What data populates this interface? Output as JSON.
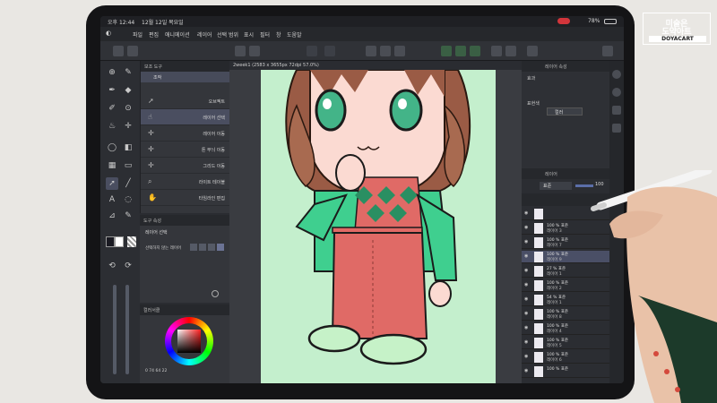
{
  "statusbar": {
    "time": "오후 12:44",
    "date": "12월 12일 목요일",
    "battery": "78%"
  },
  "menu": [
    "파일",
    "편집",
    "애니메이션",
    "레이어",
    "선택 범위",
    "표시",
    "필터",
    "창",
    "도움말"
  ],
  "subtool": {
    "header": "보조 도구",
    "tab": "조작",
    "items": [
      {
        "label": "오브젝트",
        "icon": "arrow-icon"
      },
      {
        "label": "레이어 선택",
        "icon": "hand-select-icon",
        "active": true
      },
      {
        "label": "레이어 이동",
        "icon": "move-icon"
      },
      {
        "label": "톤 무늬 이동",
        "icon": "move-icon"
      },
      {
        "label": "그리드 이동",
        "icon": "move-icon"
      },
      {
        "label": "라이트 테이블",
        "icon": "search-icon"
      },
      {
        "label": "타임라인 편집",
        "icon": "hand-icon"
      }
    ]
  },
  "toolprop": {
    "header": "도구 속성",
    "title": "레이어 선택",
    "row_label": "선택하지 않는 레이어"
  },
  "colorpanel": {
    "header": "컬러서클",
    "readout": "0  74  64  22"
  },
  "document": {
    "tab": "2week1 (2583 x 3655px 72dpi 57.0%)"
  },
  "navigator": {
    "header1": "레이어 속성",
    "label1": "효과",
    "label2": "표현색",
    "color_value": "컬러"
  },
  "layers": {
    "header": "레이어",
    "blend": "표준",
    "opacity": "100",
    "rows": [
      {
        "pct": "",
        "name": ""
      },
      {
        "pct": "100 % 표준",
        "name": "레이어 3"
      },
      {
        "pct": "100 % 표준",
        "name": "레이어 7"
      },
      {
        "pct": "100 % 표준",
        "name": "레이어 9",
        "selected": true
      },
      {
        "pct": "27 % 표준",
        "name": "레이어 1"
      },
      {
        "pct": "100 % 표준",
        "name": "레이어 2"
      },
      {
        "pct": "54 % 표준",
        "name": "레이어 1"
      },
      {
        "pct": "100 % 표준",
        "name": "레이어 8"
      },
      {
        "pct": "100 % 표준",
        "name": "레이어 4"
      },
      {
        "pct": "100 % 표준",
        "name": "레이어 5"
      },
      {
        "pct": "100 % 표준",
        "name": "레이어 6"
      },
      {
        "pct": "100 % 표준",
        "name": ""
      }
    ]
  },
  "watermark": {
    "line1": "미술은",
    "line2": "도약아트",
    "line3": "DOYACART"
  },
  "colors": {
    "canvas_bg": "#c4efcd",
    "selected_layer": "#4a4f66",
    "accent": "#5b6ea8",
    "sweater": "#3fcf8f",
    "pants": "#e06a66"
  }
}
